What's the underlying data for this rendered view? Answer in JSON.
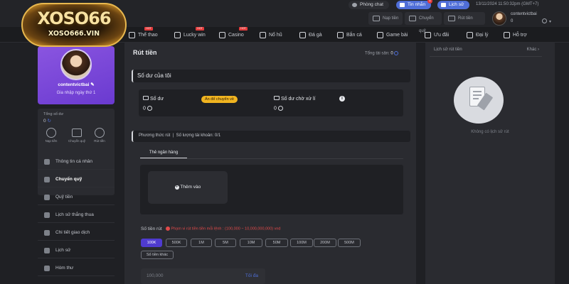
{
  "brand": {
    "logo_main": "XOSO66",
    "logo_sub": "XOSO666.VIN"
  },
  "top": {
    "chat_label": "Phòng chat",
    "inbox_label": "Tin nhắn",
    "inbox_badge": "1",
    "history_label": "Lịch sử",
    "datetime": "13/11/2024 11:50:32pm (GMT+7)",
    "deposit_label": "Nạp tiền",
    "transfer_label": "Chuyển quỹ",
    "withdraw_label": "Rút tiền",
    "username": "contentvictbai",
    "balance": "0"
  },
  "nav": [
    {
      "label": "Thể thao",
      "icon": "sports-icon",
      "hot": true
    },
    {
      "label": "Lucky win",
      "icon": "lucky-icon",
      "hot": true
    },
    {
      "label": "Casino",
      "icon": "casino-icon",
      "hot": true
    },
    {
      "label": "Nổ hũ",
      "icon": "slot-icon",
      "hot": false
    },
    {
      "label": "Đá gà",
      "icon": "rooster-icon",
      "hot": false
    },
    {
      "label": "Bắn cá",
      "icon": "fish-icon",
      "hot": false
    },
    {
      "label": "Game bài",
      "icon": "cards-icon",
      "hot": false
    },
    {
      "label": "Ưu đãi",
      "icon": "gift-icon",
      "hot": false
    },
    {
      "label": "Đại lý",
      "icon": "agent-icon",
      "hot": false
    },
    {
      "label": "Hỗ trợ",
      "icon": "support-icon",
      "hot": false
    }
  ],
  "hot_badge": "HOT",
  "sidebar": {
    "username": "contentvictbai",
    "join_text": "Gia nhập ngày thứ 1",
    "total_balance_label": "Tổng số dư",
    "total_balance": "0",
    "quick": [
      {
        "label": "Nạp tiền"
      },
      {
        "label": "Chuyển quỹ"
      },
      {
        "label": "Rút tiền"
      }
    ],
    "menu": [
      {
        "label": "Thông tin cá nhân",
        "icon": "user-icon"
      },
      {
        "label": "Chuyển quỹ",
        "icon": "transfer-icon",
        "active": true
      },
      {
        "label": "Quỹ tiền",
        "icon": "wallet-icon"
      },
      {
        "label": "Lịch sử thắng thua",
        "icon": "history-icon"
      },
      {
        "label": "Chi tiết giao dịch",
        "icon": "receipt-icon"
      },
      {
        "label": "Lịch sử",
        "icon": "chart-icon"
      },
      {
        "label": "Hòm thư",
        "icon": "mail-icon"
      }
    ]
  },
  "main": {
    "title": "Rút tiền",
    "total_assets_label": "Tổng tài sản:",
    "total_assets": "0",
    "section_balance": "Số dư của tôi",
    "balance_label": "Số dư",
    "balance_value": "0",
    "hide_transfer": "Ẩn để chuyển về",
    "pending_label": "Số dư chờ xử lí",
    "pending_value": "0",
    "method_label": "Phương thức rút",
    "account_count_label": "Số lượng tài khoản:",
    "account_count": "0/1",
    "tab_bank": "Thẻ ngân hàng",
    "add_label": "Thêm vào",
    "amount_label": "Số tiền rút",
    "amount_note": "Phạm vi rút tiền tiền mỗi lệnh : (100,000 ~ 10,000,000,000) vnd",
    "amounts": [
      "100K",
      "500K",
      "1M",
      "5M",
      "10M",
      "50M",
      "100M",
      "200M",
      "500M"
    ],
    "amount_other": "Số tiền khác",
    "input_placeholder": "100,000",
    "max_label": "Tối đa"
  },
  "right": {
    "title": "Lịch sử rút tiền",
    "more_label": "Khác",
    "empty_text": "Không có lịch sử rút"
  },
  "colors": {
    "accent": "#6a3ad0",
    "active_amount": "#4f3bd0",
    "bg": "#1f2024",
    "panel": "#2a2b30"
  }
}
